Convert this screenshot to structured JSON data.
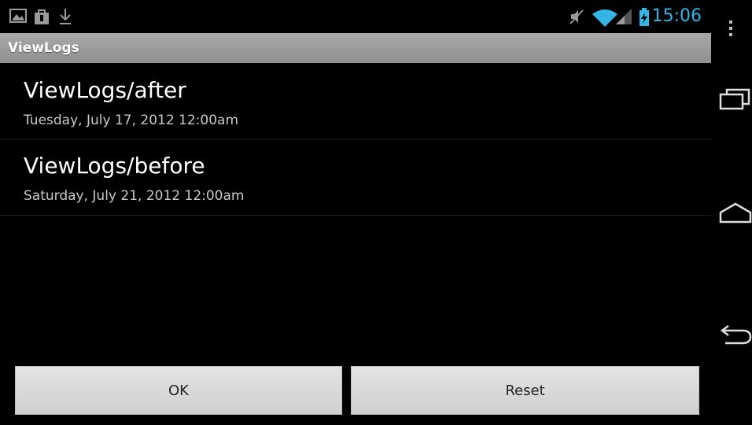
{
  "status_bar": {
    "time": "15:06",
    "left_icons": [
      "image-icon",
      "bag-icon",
      "download-icon"
    ],
    "right_icons": [
      "mute-icon",
      "wifi-icon",
      "signal-icon",
      "battery-charging-icon"
    ],
    "accent": "#33b5e5"
  },
  "title_bar": {
    "title": "ViewLogs"
  },
  "logs": [
    {
      "name": "ViewLogs/after",
      "date": "Tuesday, July 17, 2012 12:00am"
    },
    {
      "name": "ViewLogs/before",
      "date": "Saturday, July 21, 2012 12:00am"
    }
  ],
  "buttons": {
    "ok": "OK",
    "reset": "Reset"
  },
  "nav_bar": {
    "icons": [
      "overflow-menu-icon",
      "recent-apps-icon",
      "home-icon",
      "back-icon"
    ]
  }
}
